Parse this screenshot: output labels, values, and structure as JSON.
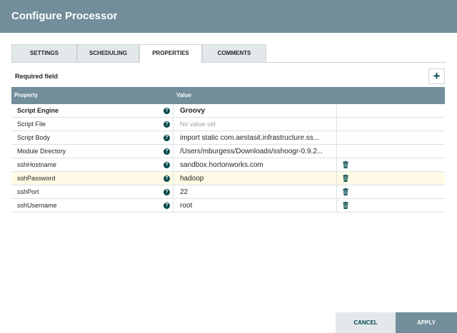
{
  "dialog": {
    "title": "Configure Processor"
  },
  "tabs": [
    {
      "label": "SETTINGS"
    },
    {
      "label": "SCHEDULING"
    },
    {
      "label": "PROPERTIES"
    },
    {
      "label": "COMMENTS"
    }
  ],
  "active_tab": "PROPERTIES",
  "required_label": "Required field",
  "add_button": "+",
  "table": {
    "headers": {
      "property": "Property",
      "value": "Value"
    },
    "rows": [
      {
        "property": "Script Engine",
        "value": "Groovy"
      },
      {
        "property": "Script File",
        "value": "No value set"
      },
      {
        "property": "Script Body",
        "value": "import static com.aestasit.infrastructure.ss..."
      },
      {
        "property": "Module Directory",
        "value": "/Users/mburgess/Downloads/sshoogr-0.9.2..."
      },
      {
        "property": "sshHostname",
        "value": "sandbox.hortonworks.com"
      },
      {
        "property": "sshPassword",
        "value": "hadoop"
      },
      {
        "property": "sshPort",
        "value": "22"
      },
      {
        "property": "sshUsername",
        "value": "root"
      }
    ]
  },
  "footer": {
    "cancel": "CANCEL",
    "apply": "APPLY"
  },
  "colors": {
    "header": "#728e9b",
    "accent": "#004849",
    "highlight": "#fffbe6"
  },
  "icons": {
    "help": "question-circle",
    "delete": "trash",
    "add": "plus"
  }
}
